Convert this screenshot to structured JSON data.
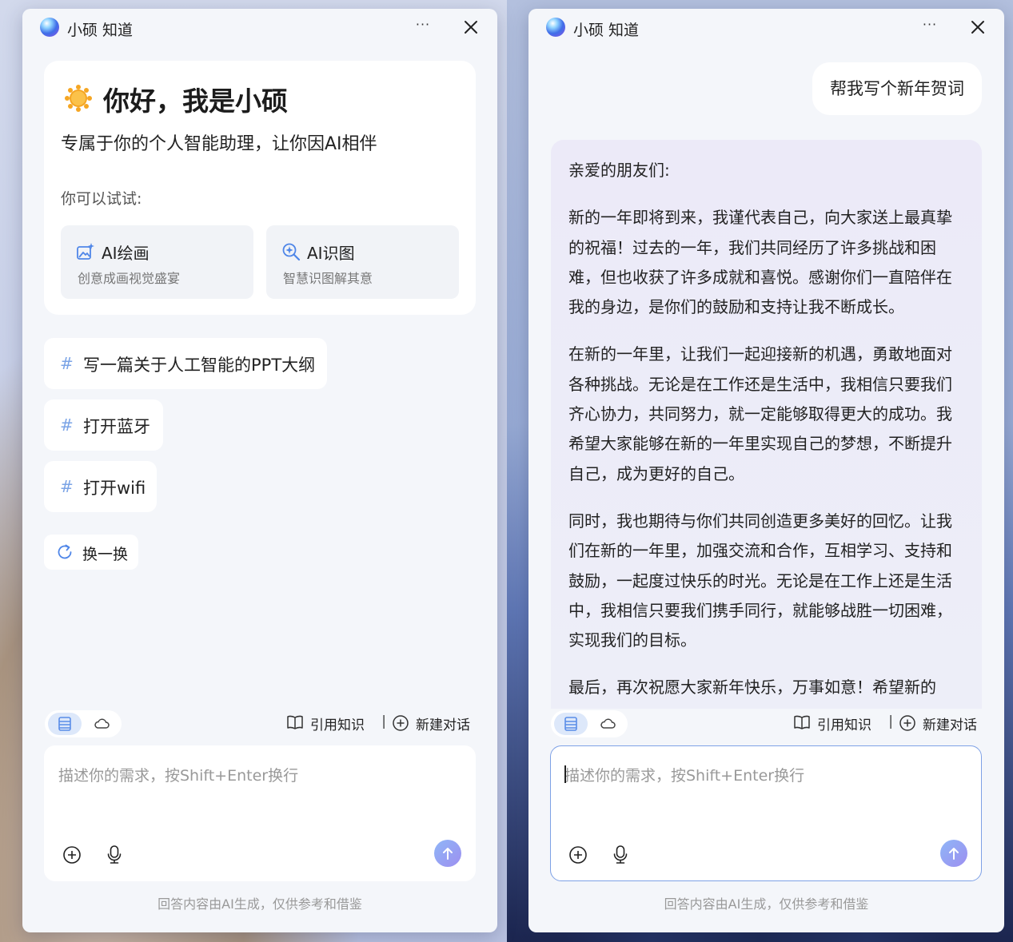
{
  "window_left": {
    "app_title": "小硕 知道",
    "more": "···",
    "greeting_title": "你好，我是小硕",
    "greeting_subtitle": "专属于你的个人智能助理，让你因AI相伴",
    "try_label": "你可以试试:",
    "features": [
      {
        "title": "AI绘画",
        "desc": "创意成画视觉盛宴",
        "icon": "image-sparkle-icon"
      },
      {
        "title": "AI识图",
        "desc": "智慧识图解其意",
        "icon": "magnify-sparkle-icon"
      }
    ],
    "suggestions": [
      "写一篇关于人工智能的PPT大纲",
      "打开蓝牙",
      "打开wifi"
    ],
    "suggestion_marker": "#",
    "refresh_label": "换一换"
  },
  "window_right": {
    "app_title": "小硕 知道",
    "more": "···",
    "user_message": "帮我写个新年贺词",
    "ai_paragraphs": [
      "亲爱的朋友们:",
      "新的一年即将到来，我谨代表自己，向大家送上最真挚的祝福！过去的一年，我们共同经历了许多挑战和困难，但也收获了许多成就和喜悦。感谢你们一直陪伴在我的身边，是你们的鼓励和支持让我不断成长。",
      "在新的一年里，让我们一起迎接新的机遇，勇敢地面对各种挑战。无论是在工作还是生活中，我相信只要我们齐心协力，共同努力，就一定能够取得更大的成功。我希望大家能够在新的一年里实现自己的梦想，不断提升自己，成为更好的自己。",
      "同时，我也期待与你们共同创造更多美好的回忆。让我们在新的一年里，加强交流和合作，互相学习、支持和鼓励，一起度过快乐的时光。无论是在工作上还是生活中，我相信只要我们携手同行，就能够战胜一切困难，实现我们的目标。",
      "最后，再次祝愿大家新年快乐，万事如意！希望新的"
    ]
  },
  "toolbar": {
    "cite_label": "引用知识",
    "separator": "|",
    "new_chat_label": "新建对话"
  },
  "input": {
    "placeholder": "描述你的需求，按Shift+Enter换行"
  },
  "disclaimer": "回答内容由AI生成，仅供参考和借鉴",
  "colors": {
    "accent_blue": "#7aa3e6",
    "send_button": "#9d8ff0",
    "sun": "#f5a623"
  }
}
